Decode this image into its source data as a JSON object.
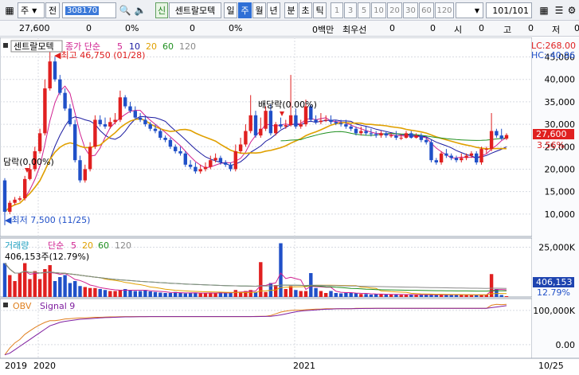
{
  "toolbar": {
    "market": "주",
    "market_arrow": "▼",
    "all_label": "전",
    "code": "308170",
    "stock_name": "센트랄모텍",
    "new_badge": "신",
    "periods": [
      "일",
      "주",
      "월",
      "년",
      "분",
      "초",
      "틱"
    ],
    "selected_period": "주",
    "intervals": [
      "1",
      "3",
      "5",
      "10",
      "20",
      "30",
      "60",
      "120"
    ],
    "count": "101",
    "count_total": "/101"
  },
  "quote": {
    "price": "27,600",
    "change": "0",
    "change_pct": "0%",
    "v3": "0",
    "v3_pct": "0%",
    "amount": "0백만",
    "priority": "최우선",
    "p1": "0",
    "p2": "0",
    "open_label": "시",
    "open": "0",
    "high_label": "고",
    "high": "0",
    "low_label": "저",
    "low": "0"
  },
  "price_panel": {
    "name_box": "센트랄모텍",
    "legend_label": "종가 단순",
    "ma_periods": [
      "5",
      "10",
      "20",
      "60",
      "120"
    ],
    "ma_colors": [
      "#d02090",
      "#1a1aa0",
      "#e0a000",
      "#209020",
      "#8a8a8a"
    ],
    "lc_label": "LC:268.00",
    "hc_label": "HC:-40.96",
    "current_price": "27,600",
    "current_pct": "3.56%",
    "high_annotation": "최고 46,750 (01/28)",
    "low_annotation": "최저 7,500 (11/25)",
    "event_dividend": "배당락(0.00%)",
    "event_left": "담락(0.00%)",
    "y_ticks": [
      "45,000",
      "40,000",
      "35,000",
      "30,000",
      "25,000",
      "20,000",
      "15,000",
      "10,000"
    ]
  },
  "volume_panel": {
    "label": "거래량",
    "legend_label": "단순",
    "ma_periods": [
      "5",
      "20",
      "60",
      "120"
    ],
    "ma_colors": [
      "#d02090",
      "#e0a000",
      "#209020",
      "#8a8a8a"
    ],
    "last_volume_note": "406,153주(12.79%)",
    "current_volume": "406,153",
    "current_pct": "12.79%",
    "y_ticks": [
      "25,000K"
    ]
  },
  "obv_panel": {
    "label": "OBV",
    "signal_label": "Signal 9",
    "y_ticks": [
      "100,000K",
      "0.00"
    ]
  },
  "x_axis": {
    "labels": [
      "2019",
      "2020",
      "2021",
      "10/25"
    ]
  },
  "colors": {
    "up": "#e02020",
    "down": "#2050c8",
    "price_badge": "#e02020",
    "volume_badge": "#1e44b0",
    "obv": "#e08020",
    "signal": "#8020a0"
  },
  "chart_data": [
    {
      "type": "candlestick",
      "title": "센트랄모텍 종가",
      "x": [
        "2019-11-25",
        "2019-12-02",
        "2019-12-09",
        "2019-12-16",
        "2019-12-23",
        "2019-12-30",
        "2020-01-06",
        "2020-01-13",
        "2020-01-20",
        "2020-01-27",
        "2020-02-03",
        "2020-02-10",
        "2020-02-17",
        "2020-02-24",
        "2020-03-02",
        "2020-03-09",
        "2020-03-16",
        "2020-03-23",
        "2020-03-30",
        "2020-04-06",
        "2020-04-13",
        "2020-04-20",
        "2020-04-27",
        "2020-05-04",
        "2020-05-11",
        "2020-05-18",
        "2020-05-25",
        "2020-06-01",
        "2020-06-08",
        "2020-06-15",
        "2020-06-22",
        "2020-06-29",
        "2020-07-06",
        "2020-07-13",
        "2020-07-20",
        "2020-07-27",
        "2020-08-03",
        "2020-08-10",
        "2020-08-17",
        "2020-08-24",
        "2020-08-31",
        "2020-09-07",
        "2020-09-14",
        "2020-09-21",
        "2020-09-28",
        "2020-10-05",
        "2020-10-12",
        "2020-10-19",
        "2020-10-26",
        "2020-11-02",
        "2020-11-09",
        "2020-11-16",
        "2020-11-23",
        "2020-11-30",
        "2020-12-07",
        "2020-12-14",
        "2020-12-21",
        "2020-12-28",
        "2021-01-04",
        "2021-01-11",
        "2021-01-18",
        "2021-01-25",
        "2021-02-01",
        "2021-02-08",
        "2021-02-15",
        "2021-02-22",
        "2021-03-01",
        "2021-03-08",
        "2021-03-15",
        "2021-03-22",
        "2021-03-29",
        "2021-04-05",
        "2021-04-12",
        "2021-04-19",
        "2021-04-26",
        "2021-05-03",
        "2021-05-10",
        "2021-05-17",
        "2021-05-24",
        "2021-05-31",
        "2021-06-07",
        "2021-06-14",
        "2021-06-21",
        "2021-06-28",
        "2021-07-05",
        "2021-07-12",
        "2021-07-19",
        "2021-07-26",
        "2021-08-02",
        "2021-08-09",
        "2021-08-16",
        "2021-08-23",
        "2021-08-30",
        "2021-09-06",
        "2021-09-13",
        "2021-09-20",
        "2021-09-27",
        "2021-10-04",
        "2021-10-11",
        "2021-10-18",
        "2021-10-25"
      ],
      "open": [
        17500,
        10500,
        12500,
        13200,
        13500,
        17800,
        20000,
        24000,
        28000,
        38000,
        44000,
        40000,
        37000,
        33500,
        30000,
        22000,
        17500,
        20000,
        25000,
        31000,
        30000,
        29500,
        30500,
        31000,
        36000,
        34000,
        33000,
        31500,
        31000,
        30000,
        29000,
        28500,
        27000,
        26500,
        25000,
        24000,
        23500,
        21000,
        20500,
        19500,
        20000,
        20500,
        22000,
        22500,
        21500,
        21000,
        20000,
        24000,
        25500,
        28500,
        32000,
        27500,
        29000,
        33000,
        28000,
        30000,
        29500,
        29800,
        32000,
        29500,
        30000,
        34000,
        31000,
        30500,
        30800,
        31000,
        30500,
        30200,
        30000,
        29500,
        29000,
        28000,
        28500,
        28000,
        27800,
        27500,
        28000,
        27500,
        27500,
        27000,
        27000,
        28000,
        27000,
        27500,
        26500,
        26000,
        22000,
        21500,
        23500,
        23000,
        22500,
        22000,
        22500,
        23000,
        23500,
        21500,
        24500,
        24500,
        28500,
        27500,
        26800
      ],
      "close": [
        10500,
        12500,
        13200,
        13500,
        17800,
        20000,
        24000,
        28000,
        38000,
        44000,
        40000,
        37000,
        33500,
        30000,
        22000,
        17500,
        20000,
        25000,
        31000,
        30000,
        29500,
        30500,
        31000,
        36000,
        34000,
        33000,
        31500,
        31000,
        30000,
        29000,
        28500,
        27000,
        26500,
        25000,
        24000,
        23500,
        21000,
        20500,
        19500,
        20000,
        20500,
        22000,
        22500,
        21500,
        21000,
        20000,
        24000,
        25500,
        28500,
        32000,
        27500,
        29000,
        33000,
        28000,
        30000,
        29500,
        29800,
        32000,
        29500,
        30000,
        34000,
        31000,
        30500,
        30800,
        31000,
        30500,
        30200,
        30000,
        29500,
        29000,
        28000,
        28500,
        28000,
        27800,
        27500,
        28000,
        27500,
        27500,
        27000,
        27000,
        28000,
        27000,
        27500,
        26500,
        26000,
        22000,
        21500,
        23500,
        23000,
        22500,
        22000,
        22500,
        23000,
        23500,
        21500,
        24500,
        24500,
        28500,
        27500,
        26800,
        27600
      ],
      "high": [
        18000,
        13000,
        13800,
        14000,
        18500,
        21000,
        25000,
        29000,
        40000,
        46750,
        45000,
        41000,
        38000,
        34500,
        31000,
        23000,
        21000,
        26000,
        32000,
        32000,
        31500,
        31500,
        32500,
        37500,
        36500,
        35000,
        34000,
        32500,
        32000,
        30500,
        30000,
        29000,
        27500,
        27000,
        25500,
        25000,
        24000,
        22000,
        21500,
        21000,
        21500,
        23000,
        23500,
        23000,
        22000,
        21500,
        25500,
        27000,
        30000,
        36500,
        33000,
        31500,
        34000,
        34500,
        30500,
        31500,
        31000,
        41000,
        33500,
        31000,
        35500,
        34500,
        32000,
        32500,
        32000,
        32000,
        31000,
        31000,
        31000,
        30000,
        29500,
        29500,
        29500,
        29000,
        28500,
        28500,
        28500,
        28000,
        28500,
        27800,
        28500,
        28500,
        28000,
        28000,
        27000,
        26500,
        22500,
        24000,
        24500,
        23500,
        23000,
        23500,
        23500,
        24000,
        24000,
        25000,
        25000,
        32500,
        29000,
        29000,
        28000
      ],
      "low": [
        7500,
        10000,
        12000,
        12800,
        13000,
        17500,
        19500,
        23500,
        27500,
        37500,
        39500,
        36500,
        33000,
        29500,
        21500,
        17000,
        17000,
        19500,
        24500,
        29500,
        29000,
        29000,
        30000,
        30500,
        33500,
        32500,
        31000,
        30500,
        29500,
        28500,
        28000,
        26500,
        26000,
        24500,
        23500,
        23000,
        20500,
        20000,
        19000,
        19000,
        19500,
        20000,
        21500,
        21000,
        20500,
        19500,
        19500,
        23500,
        25000,
        28000,
        27000,
        27000,
        28500,
        27500,
        27500,
        29000,
        29000,
        29500,
        29000,
        29000,
        29500,
        30500,
        30000,
        30000,
        30500,
        30000,
        29800,
        29500,
        29000,
        28500,
        27500,
        27500,
        27500,
        27300,
        27000,
        27000,
        27000,
        27000,
        26500,
        26500,
        26800,
        26800,
        26800,
        26000,
        25500,
        21500,
        21000,
        21000,
        22500,
        22000,
        21500,
        21500,
        22000,
        22500,
        21000,
        21000,
        23500,
        24000,
        27000,
        26500,
        26500
      ],
      "ylim": [
        5000,
        49000
      ],
      "moving_averages": [
        "5",
        "10",
        "20",
        "60",
        "120"
      ]
    },
    {
      "type": "bar",
      "title": "거래량",
      "values_k": [
        17000,
        11000,
        8000,
        12000,
        17000,
        9000,
        13000,
        9000,
        14000,
        16000,
        8000,
        10000,
        11000,
        7000,
        8000,
        5500,
        5000,
        4500,
        4500,
        4000,
        3500,
        3000,
        3000,
        3500,
        4000,
        3500,
        3000,
        3000,
        3500,
        2800,
        2500,
        2200,
        2000,
        2000,
        2500,
        2000,
        1800,
        2000,
        2200,
        1800,
        2000,
        2000,
        1800,
        2500,
        2000,
        2000,
        3500,
        2500,
        3000,
        3500,
        2500,
        17500,
        2500,
        7000,
        6000,
        27000,
        4000,
        5500,
        3500,
        3000,
        3000,
        12000,
        4500,
        3000,
        2000,
        3000,
        2000,
        1800,
        2200,
        2000,
        1800,
        1500,
        1500,
        1200,
        1400,
        1500,
        1200,
        1300,
        1200,
        1000,
        1300,
        1200,
        1200,
        1100,
        1000,
        1200,
        1000,
        1100,
        1300,
        1000,
        1200,
        1000,
        1000,
        900,
        1000,
        1200,
        1100,
        11500,
        4000,
        1000,
        406
      ],
      "ylim": [
        0,
        28000
      ]
    },
    {
      "type": "line",
      "title": "OBV",
      "series": [
        {
          "name": "OBV",
          "values": [
            -30000,
            -10000,
            5000,
            15000,
            30000,
            40000,
            50000,
            58000,
            65000,
            70000,
            70000,
            72000,
            75000,
            76000,
            77000,
            78000,
            78000,
            79000,
            80000,
            80000,
            80500,
            81000,
            81000,
            81500,
            82000,
            82000,
            82000,
            82000,
            82000,
            82000,
            82000,
            82000,
            82000,
            82000,
            82000,
            82000,
            82000,
            82000,
            82000,
            82000,
            82000,
            82000,
            82000,
            82000,
            82000,
            82000,
            82000,
            82000,
            82000,
            82000,
            82500,
            83000,
            83000,
            85000,
            90000,
            95000,
            98000,
            100000,
            101000,
            101000,
            102000,
            103000,
            104000,
            104000,
            105000,
            105000,
            105000,
            105000,
            105000,
            105000,
            106000,
            106000,
            106000,
            106000,
            106000,
            106000,
            106000,
            106000,
            106000,
            106000,
            106000,
            106000,
            106000,
            106000,
            106000,
            106000,
            106000,
            106000,
            106000,
            106000,
            106000,
            106000,
            106000,
            106000,
            106000,
            106000,
            106000,
            115000,
            118000,
            117000,
            118000
          ]
        },
        {
          "name": "Signal 9",
          "values": [
            -30000,
            -25000,
            -15000,
            -5000,
            5000,
            15000,
            25000,
            35000,
            45000,
            55000,
            60000,
            65000,
            68000,
            70000,
            72000,
            74000,
            75000,
            76000,
            77000,
            78000,
            79000,
            79500,
            80000,
            80500,
            81000,
            81200,
            81400,
            81600,
            81800,
            82000,
            82000,
            82000,
            82000,
            82000,
            82000,
            82000,
            82000,
            82000,
            82000,
            82000,
            82000,
            82000,
            82000,
            82000,
            82000,
            82000,
            82000,
            82000,
            82000,
            82000,
            82100,
            82300,
            82500,
            83000,
            84500,
            87000,
            90000,
            93000,
            96000,
            98000,
            99500,
            100500,
            101500,
            102500,
            103500,
            104000,
            104500,
            104800,
            105000,
            105000,
            105300,
            105500,
            105700,
            105800,
            105900,
            106000,
            106000,
            106000,
            106000,
            106000,
            106000,
            106000,
            106000,
            106000,
            106000,
            106000,
            106000,
            106000,
            106000,
            106000,
            106000,
            106000,
            106000,
            106000,
            106000,
            106000,
            106000,
            108000,
            110000,
            112000,
            114000
          ]
        }
      ],
      "ylim": [
        -40000,
        130000
      ]
    }
  ]
}
